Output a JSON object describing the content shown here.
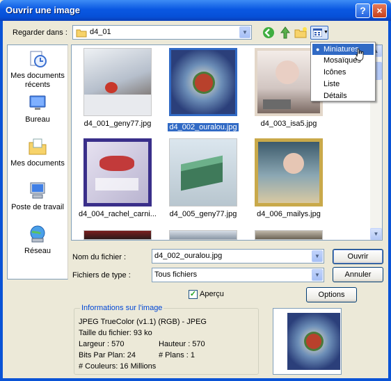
{
  "window": {
    "title": "Ouvrir une image",
    "help_label": "?",
    "close_label": "×"
  },
  "location": {
    "label": "Regarder dans :",
    "value": "d4_01"
  },
  "places": [
    {
      "label": "Mes documents récents",
      "icon": "recent-documents-icon"
    },
    {
      "label": "Bureau",
      "icon": "desktop-icon"
    },
    {
      "label": "Mes documents",
      "icon": "my-documents-icon"
    },
    {
      "label": "Poste de travail",
      "icon": "my-computer-icon"
    },
    {
      "label": "Réseau",
      "icon": "network-icon"
    }
  ],
  "files": [
    {
      "name": "d4_001_geny77.jpg",
      "selected": false
    },
    {
      "name": "d4_002_ouralou.jpg",
      "selected": true
    },
    {
      "name": "d4_003_isa5.jpg",
      "selected": false
    },
    {
      "name": "d4_004_rachel_carni...",
      "selected": false
    },
    {
      "name": "d4_005_geny77.jpg",
      "selected": false
    },
    {
      "name": "d4_006_mailys.jpg",
      "selected": false
    }
  ],
  "view_menu": {
    "items": [
      "Miniatures",
      "Mosaïques",
      "Icônes",
      "Liste",
      "Détails"
    ],
    "active": "Miniatures"
  },
  "filename": {
    "label": "Nom du fichier :",
    "value": "d4_002_ouralou.jpg"
  },
  "filetype": {
    "label": "Fichiers de type :",
    "value": "Tous fichiers"
  },
  "buttons": {
    "open": "Ouvrir",
    "cancel": "Annuler",
    "options": "Options"
  },
  "preview_checkbox": {
    "label": "Aperçu",
    "checked": true
  },
  "info": {
    "title": "Informations sur l'image",
    "format": "JPEG TrueColor (v1.1) (RGB) - JPEG",
    "size": "Taille du fichier: 93 ko",
    "width": "Largeur : 570",
    "height": "Hauteur : 570",
    "bits": "Bits Par Plan: 24",
    "planes": "# Plans : 1",
    "colors": "# Couleurs: 16 Millions"
  },
  "colors": {
    "title_bar": "#0a58e2",
    "selection": "#316ac5",
    "dialog_bg": "#ece9d8"
  }
}
